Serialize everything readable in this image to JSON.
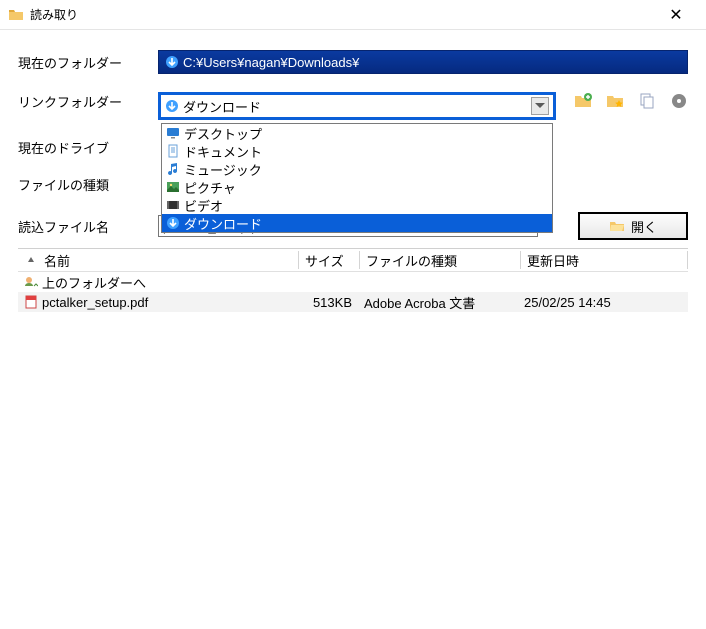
{
  "window": {
    "title": "読み取り"
  },
  "labels": {
    "current_folder": "現在のフォルダー",
    "link_folder": "リンクフォルダー",
    "current_drive": "現在のドライブ",
    "file_type": "ファイルの種類",
    "read_filename": "読込ファイル名"
  },
  "path": "C:¥Users¥nagan¥Downloads¥",
  "combo_selected": "ダウンロード",
  "dropdown": {
    "items": [
      {
        "icon": "desktop",
        "label": "デスクトップ"
      },
      {
        "icon": "document",
        "label": "ドキュメント"
      },
      {
        "icon": "music",
        "label": "ミュージック"
      },
      {
        "icon": "picture",
        "label": "ピクチャ"
      },
      {
        "icon": "video",
        "label": "ビデオ"
      },
      {
        "icon": "download",
        "label": "ダウンロード",
        "selected": true
      }
    ]
  },
  "filename_value": "pctalker_setup.pdf",
  "open_button": "開く",
  "columns": {
    "name": "名前",
    "size": "サイズ",
    "type": "ファイルの種類",
    "date": "更新日時"
  },
  "rows": [
    {
      "icon": "up",
      "name": "上のフォルダーへ",
      "size": "",
      "type": "",
      "date": "",
      "selected": false
    },
    {
      "icon": "pdf",
      "name": "pctalker_setup.pdf",
      "size": "513KB",
      "type": "Adobe Acroba 文書",
      "date": "25/02/25 14:45",
      "selected": true
    }
  ]
}
